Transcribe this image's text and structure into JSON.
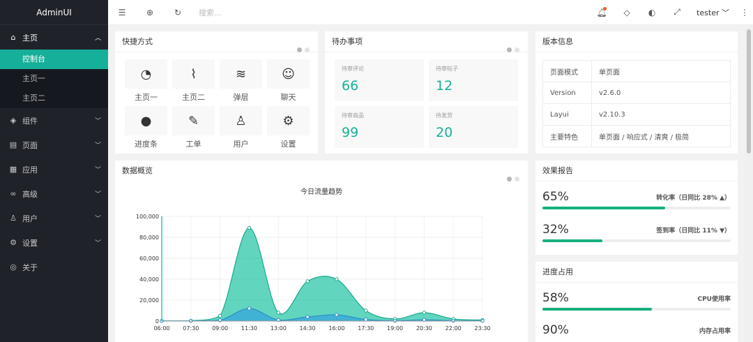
{
  "app": {
    "title": "AdminUI"
  },
  "sidebar": {
    "home": {
      "label": "主页",
      "subs": [
        "控制台",
        "主页一",
        "主页二"
      ]
    },
    "items": [
      {
        "label": "组件",
        "icon": "cube-icon"
      },
      {
        "label": "页面",
        "icon": "page-icon"
      },
      {
        "label": "应用",
        "icon": "app-icon"
      },
      {
        "label": "高级",
        "icon": "senior-icon"
      },
      {
        "label": "用户",
        "icon": "user-icon"
      },
      {
        "label": "设置",
        "icon": "gear-icon"
      },
      {
        "label": "关于",
        "icon": "shield-icon"
      }
    ]
  },
  "topbar": {
    "search_placeholder": "搜索...",
    "user": "tester"
  },
  "shortcuts": {
    "title": "快捷方式",
    "items": [
      "主页一",
      "主页二",
      "弹层",
      "聊天",
      "进度条",
      "工单",
      "用户",
      "设置"
    ]
  },
  "todo": {
    "title": "待办事项",
    "items": [
      {
        "label": "待审评论",
        "value": "66"
      },
      {
        "label": "待审帖子",
        "value": "12"
      },
      {
        "label": "待审商品",
        "value": "99"
      },
      {
        "label": "待发货",
        "value": "20"
      }
    ]
  },
  "version": {
    "title": "版本信息",
    "rows": [
      [
        "页面模式",
        "单页面"
      ],
      [
        "Version",
        "v2.6.0"
      ],
      [
        "Layui",
        "v2.10.3"
      ],
      [
        "主要特色",
        "单页面 / 响应式 / 清爽 / 极简"
      ]
    ]
  },
  "report": {
    "title": "效果报告",
    "items": [
      {
        "value": "65%",
        "label": "转化率（日同比 28% ▲）",
        "pct": 65
      },
      {
        "value": "32%",
        "label": "签到率（日同比 11% ▼）",
        "pct": 32
      }
    ]
  },
  "progress": {
    "title": "进度占用",
    "items": [
      {
        "value": "58%",
        "label": "CPU使用率",
        "pct": 58
      },
      {
        "value": "90%",
        "label": "内存占用率",
        "pct": 90
      }
    ]
  },
  "overview": {
    "title": "数据概览"
  },
  "chart_data": {
    "type": "area",
    "title": "今日流量趋势",
    "x": [
      "06:00",
      "07:30",
      "09:00",
      "11:30",
      "13:00",
      "14:30",
      "16:00",
      "17:30",
      "19:00",
      "20:30",
      "22:00",
      "23:30"
    ],
    "ylim": [
      0,
      100000
    ],
    "yticks": [
      "0",
      "20,000",
      "40,000",
      "60,000",
      "80,000",
      "100,000"
    ],
    "series": [
      {
        "values": [
          200,
          300,
          5000,
          89000,
          8000,
          38000,
          40000,
          10000,
          2000,
          8000,
          2000,
          1000
        ],
        "color": "#2ec7a9"
      },
      {
        "values": [
          100,
          100,
          800,
          12000,
          1000,
          4000,
          6000,
          1500,
          300,
          1200,
          300,
          200
        ],
        "color": "#3aa7d9"
      }
    ]
  }
}
